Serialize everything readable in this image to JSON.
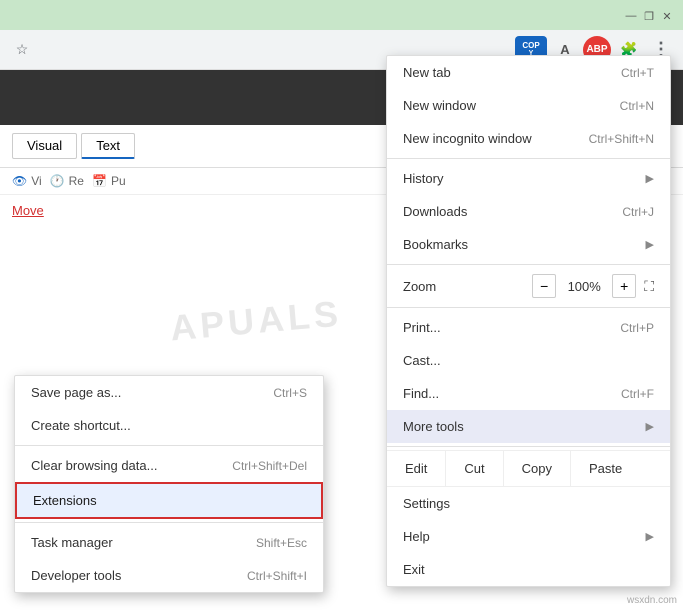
{
  "titleBar": {
    "minimize": "—",
    "restore": "❐",
    "close": "✕"
  },
  "toolbar": {
    "bookmark": "☆",
    "extensionCopyLine1": "COP",
    "extensionCopyLine2": "Y",
    "abpLabel": "ABP",
    "puzzle": "🧩",
    "moreVert": "⋮"
  },
  "pageTabs": {
    "visual": "Visual",
    "text": "Text"
  },
  "pageIcons": {
    "view": "Vi",
    "refresh": "Re",
    "publish": "Pu"
  },
  "moveLink": "Move",
  "mainMenu": {
    "items": [
      {
        "label": "New tab",
        "shortcut": "Ctrl+T",
        "arrow": ""
      },
      {
        "label": "New window",
        "shortcut": "Ctrl+N",
        "arrow": ""
      },
      {
        "label": "New incognito window",
        "shortcut": "Ctrl+Shift+N",
        "arrow": ""
      },
      {
        "label": "History",
        "shortcut": "",
        "arrow": "▶"
      },
      {
        "label": "Downloads",
        "shortcut": "Ctrl+J",
        "arrow": ""
      },
      {
        "label": "Bookmarks",
        "shortcut": "",
        "arrow": "▶"
      },
      {
        "label": "Zoom",
        "shortcut": "",
        "isZoom": true
      },
      {
        "label": "Print...",
        "shortcut": "Ctrl+P",
        "arrow": ""
      },
      {
        "label": "Cast...",
        "shortcut": "",
        "arrow": ""
      },
      {
        "label": "Find...",
        "shortcut": "Ctrl+F",
        "arrow": ""
      },
      {
        "label": "More tools",
        "shortcut": "",
        "arrow": "▶",
        "active": true
      },
      {
        "label": "Settings",
        "shortcut": "",
        "arrow": ""
      },
      {
        "label": "Help",
        "shortcut": "",
        "arrow": "▶"
      },
      {
        "label": "Exit",
        "shortcut": "",
        "arrow": ""
      }
    ],
    "zoom": {
      "label": "Zoom",
      "minus": "−",
      "value": "100%",
      "plus": "+",
      "fullscreen": "⛶"
    }
  },
  "editSubmenu": {
    "items": [
      {
        "label": "Edit"
      },
      {
        "label": "Cut"
      },
      {
        "label": "Copy"
      },
      {
        "label": "Paste"
      }
    ]
  },
  "leftMenu": {
    "items": [
      {
        "label": "Save page as...",
        "shortcut": "Ctrl+S"
      },
      {
        "label": "Create shortcut...",
        "shortcut": ""
      },
      {
        "label": "Clear browsing data...",
        "shortcut": "Ctrl+Shift+Del"
      },
      {
        "label": "Extensions",
        "shortcut": "",
        "highlighted": true
      },
      {
        "label": "Task manager",
        "shortcut": "Shift+Esc"
      },
      {
        "label": "Developer tools",
        "shortcut": "Ctrl+Shift+I"
      }
    ]
  },
  "watermark": "wsxdn.com",
  "apualsText": "APUALS"
}
